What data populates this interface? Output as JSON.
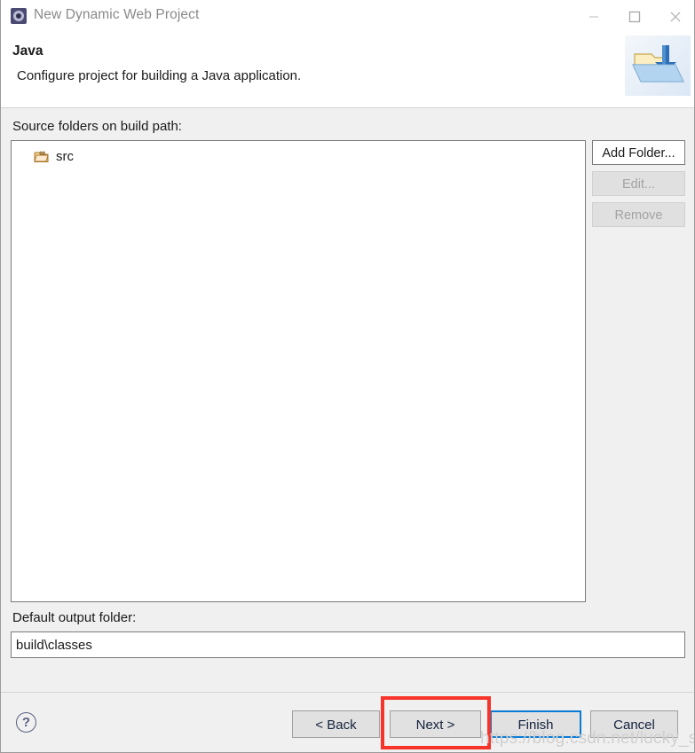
{
  "window": {
    "title": "New Dynamic Web Project",
    "title_icon": "eclipse-wizard-icon",
    "controls": {
      "minimize": "minimize-icon",
      "maximize": "maximize-icon",
      "close": "close-icon"
    }
  },
  "header": {
    "title": "Java",
    "description": "Configure project for building a Java application.",
    "banner_icon": "java-folder-banner-icon"
  },
  "main": {
    "source_folders_label": "Source folders on build path:",
    "source_folders": [
      {
        "name": "src",
        "icon": "source-folder-icon"
      }
    ],
    "side_buttons": [
      {
        "label": "Add Folder...",
        "name": "add-folder-button",
        "enabled": true
      },
      {
        "label": "Edit...",
        "name": "edit-button",
        "enabled": false
      },
      {
        "label": "Remove",
        "name": "remove-button",
        "enabled": false
      }
    ],
    "output_folder_label": "Default output folder:",
    "output_folder_value": "build\\classes",
    "output_folder_placeholder": ""
  },
  "footer": {
    "help_icon": "help-question-icon",
    "buttons": {
      "back": "< Back",
      "next": "Next >",
      "finish": "Finish",
      "cancel": "Cancel"
    },
    "default_button": "Finish"
  },
  "annotation": {
    "highlight_target": "Next >",
    "highlight_color": "#f7342a"
  },
  "watermark": {
    "text": "https://blog.csdn.net/lucky_shi"
  },
  "colors": {
    "accent_blue": "#0a7bd4",
    "annotation_red": "#f7342a",
    "dialog_bg": "#f0f0f0",
    "field_bg": "#ffffff"
  }
}
